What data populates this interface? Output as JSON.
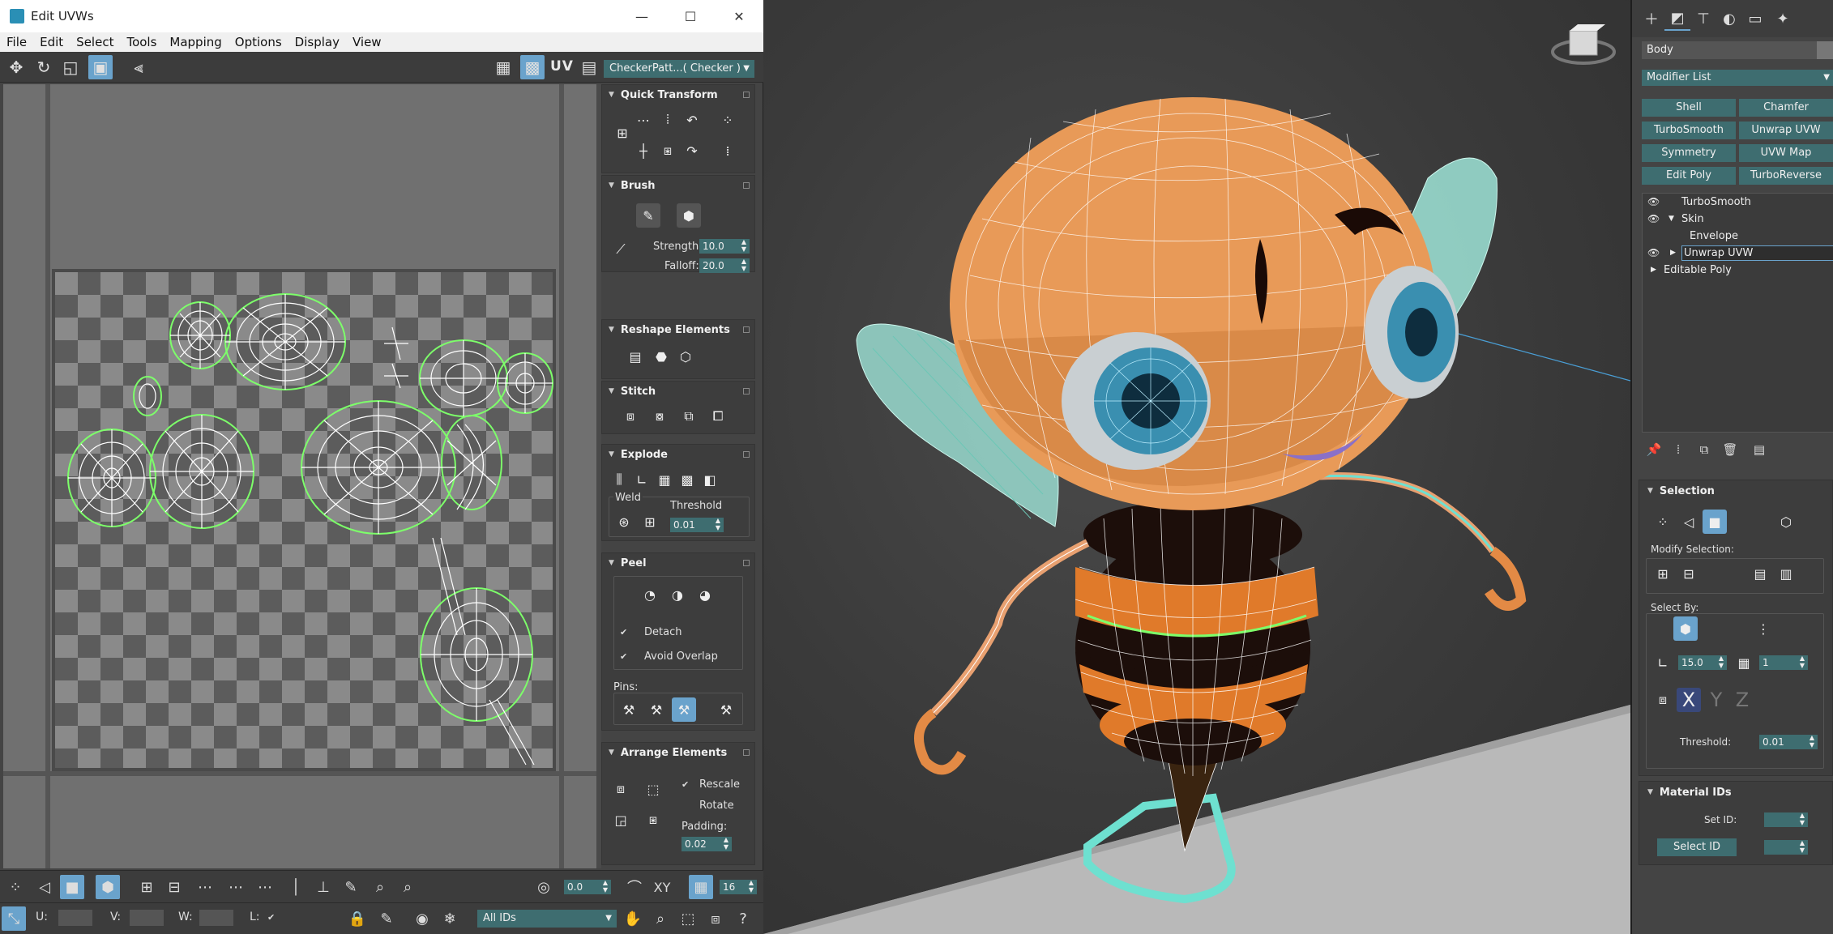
{
  "window": {
    "title": "Edit UVWs",
    "minimize": "—",
    "maximize": "☐",
    "close": "✕"
  },
  "menu": [
    "File",
    "Edit",
    "Select",
    "Tools",
    "Mapping",
    "Options",
    "Display",
    "View"
  ],
  "toolbar": {
    "uv_label": "UV",
    "checker_dropdown": "CheckerPatt...( Checker )"
  },
  "rollouts": {
    "quick_transform": "Quick Transform",
    "brush": "Brush",
    "brush_strength_label": "Strength:",
    "brush_strength": "10.0",
    "brush_falloff_label": "Falloff:",
    "brush_falloff": "20.0",
    "reshape": "Reshape Elements",
    "stitch": "Stitch",
    "explode": "Explode",
    "weld_label": "Weld",
    "threshold_label": "Threshold",
    "threshold": "0.01",
    "peel": "Peel",
    "detach_label": "Detach",
    "avoid_overlap_label": "Avoid Overlap",
    "pins_label": "Pins:",
    "arrange": "Arrange Elements",
    "rescale_label": "Rescale",
    "rotate_label": "Rotate",
    "padding_label": "Padding:",
    "padding": "0.02"
  },
  "bottom": {
    "spin_value": "0.0",
    "xy_label": "XY",
    "grid_value": "16",
    "u_label": "U:",
    "v_label": "V:",
    "w_label": "W:",
    "l_label": "L:",
    "ids_dropdown": "All IDs"
  },
  "command_panel": {
    "object_name": "Body",
    "modifier_list": "Modifier List",
    "modifier_buttons": [
      "Shell",
      "Chamfer",
      "TurboSmooth",
      "Unwrap UVW",
      "Symmetry",
      "UVW Map",
      "Edit Poly",
      "TurboReverse"
    ],
    "stack": [
      "TurboSmooth",
      "Skin",
      "Envelope",
      "Unwrap UVW",
      "Editable Poly"
    ],
    "selection_title": "Selection",
    "modify_selection_label": "Modify Selection:",
    "select_by_label": "Select By:",
    "angle_value": "15.0",
    "ring_value": "1",
    "threshold_label": "Threshold:",
    "threshold_value": "0.01",
    "axis_x": "X",
    "axis_y": "Y",
    "axis_z": "Z",
    "material_ids_title": "Material IDs",
    "set_id_label": "Set ID:",
    "select_id_label": "Select ID"
  },
  "colors": {
    "accent": "#6aa3cc",
    "spinner_bg": "#3e6d70",
    "body_orange": "#e5954f",
    "stripe_dark": "#1a0d0a",
    "wing_cyan": "#9fe5d8",
    "eye_blue": "#3a8fb0"
  }
}
